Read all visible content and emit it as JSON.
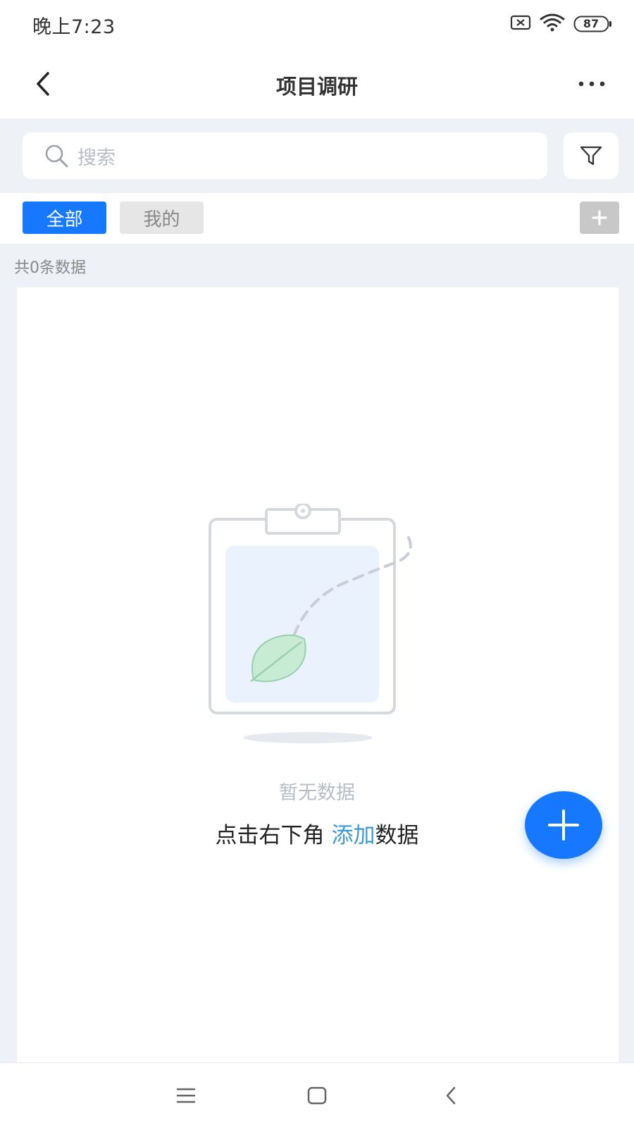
{
  "status_bar": {
    "time": "晚上7:23",
    "battery": "87",
    "icons": [
      "sim-off-icon",
      "wifi-icon",
      "battery-icon"
    ]
  },
  "nav": {
    "title": "项目调研",
    "back_icon": "chevron-left-icon",
    "more_icon": "more-dots-icon"
  },
  "search": {
    "placeholder": "搜索",
    "filter_icon": "filter-icon"
  },
  "tabs": [
    {
      "label": "全部",
      "active": true
    },
    {
      "label": "我的",
      "active": false
    }
  ],
  "count_text": "共0条数据",
  "empty_state": {
    "illustration": "clipboard-leaf-illustration",
    "title": "暂无数据",
    "hint_prefix": "点击右下角",
    "hint_link": "添加",
    "hint_suffix": "数据"
  },
  "colors": {
    "primary": "#1677ff",
    "link": "#3a9bd5",
    "page_bg": "#eef2f7",
    "muted_text": "#b8bcc4"
  },
  "system_nav": {
    "icons": [
      "menu-icon",
      "home-icon",
      "back-icon"
    ]
  }
}
